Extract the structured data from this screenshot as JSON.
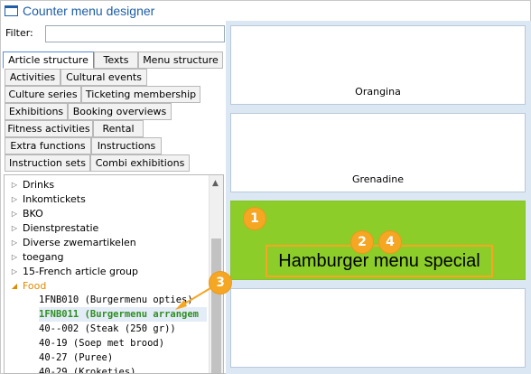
{
  "window": {
    "title": "Counter menu designer"
  },
  "filter": {
    "label": "Filter:",
    "value": "",
    "placeholder": ""
  },
  "tabs": [
    "Article structure",
    "Texts",
    "Menu structure",
    "Activities",
    "Cultural events",
    "Culture series",
    "Ticketing membership",
    "Exhibitions",
    "Booking overviews",
    "Fitness activities",
    "Rental",
    "Extra functions",
    "Instructions",
    "Instruction sets",
    "Combi exhibitions"
  ],
  "active_tab": "Article structure",
  "tree": {
    "groups": [
      "Drinks",
      "Inkomtickets",
      "BKO",
      "Dienstprestatie",
      "Diverse zwemartikelen",
      "toegang",
      "15-French article group",
      "Food"
    ],
    "children": [
      "1FNB010 (Burgermenu opties)",
      "1FNB011 (Burgermenu arrangem",
      "40--002 (Steak (250 gr))",
      "40-19 (Soep met brood)",
      "40-27 (Puree)",
      "40-29 (Kroketjes)"
    ]
  },
  "tiles": {
    "orangina": "Orangina",
    "grenadine": "Grenadine",
    "hamburger": "Hamburger menu special",
    "empty": ""
  },
  "badges": {
    "b1": "1",
    "b2": "2",
    "b3": "3",
    "b4": "4"
  },
  "colors": {
    "accent": "#f5a623",
    "selected_tile": "#8ccd2a",
    "panel_bg": "#dbe8f4",
    "title": "#1f5fa8",
    "selected_text": "#2f8f22",
    "open_group": "#e08a00"
  }
}
